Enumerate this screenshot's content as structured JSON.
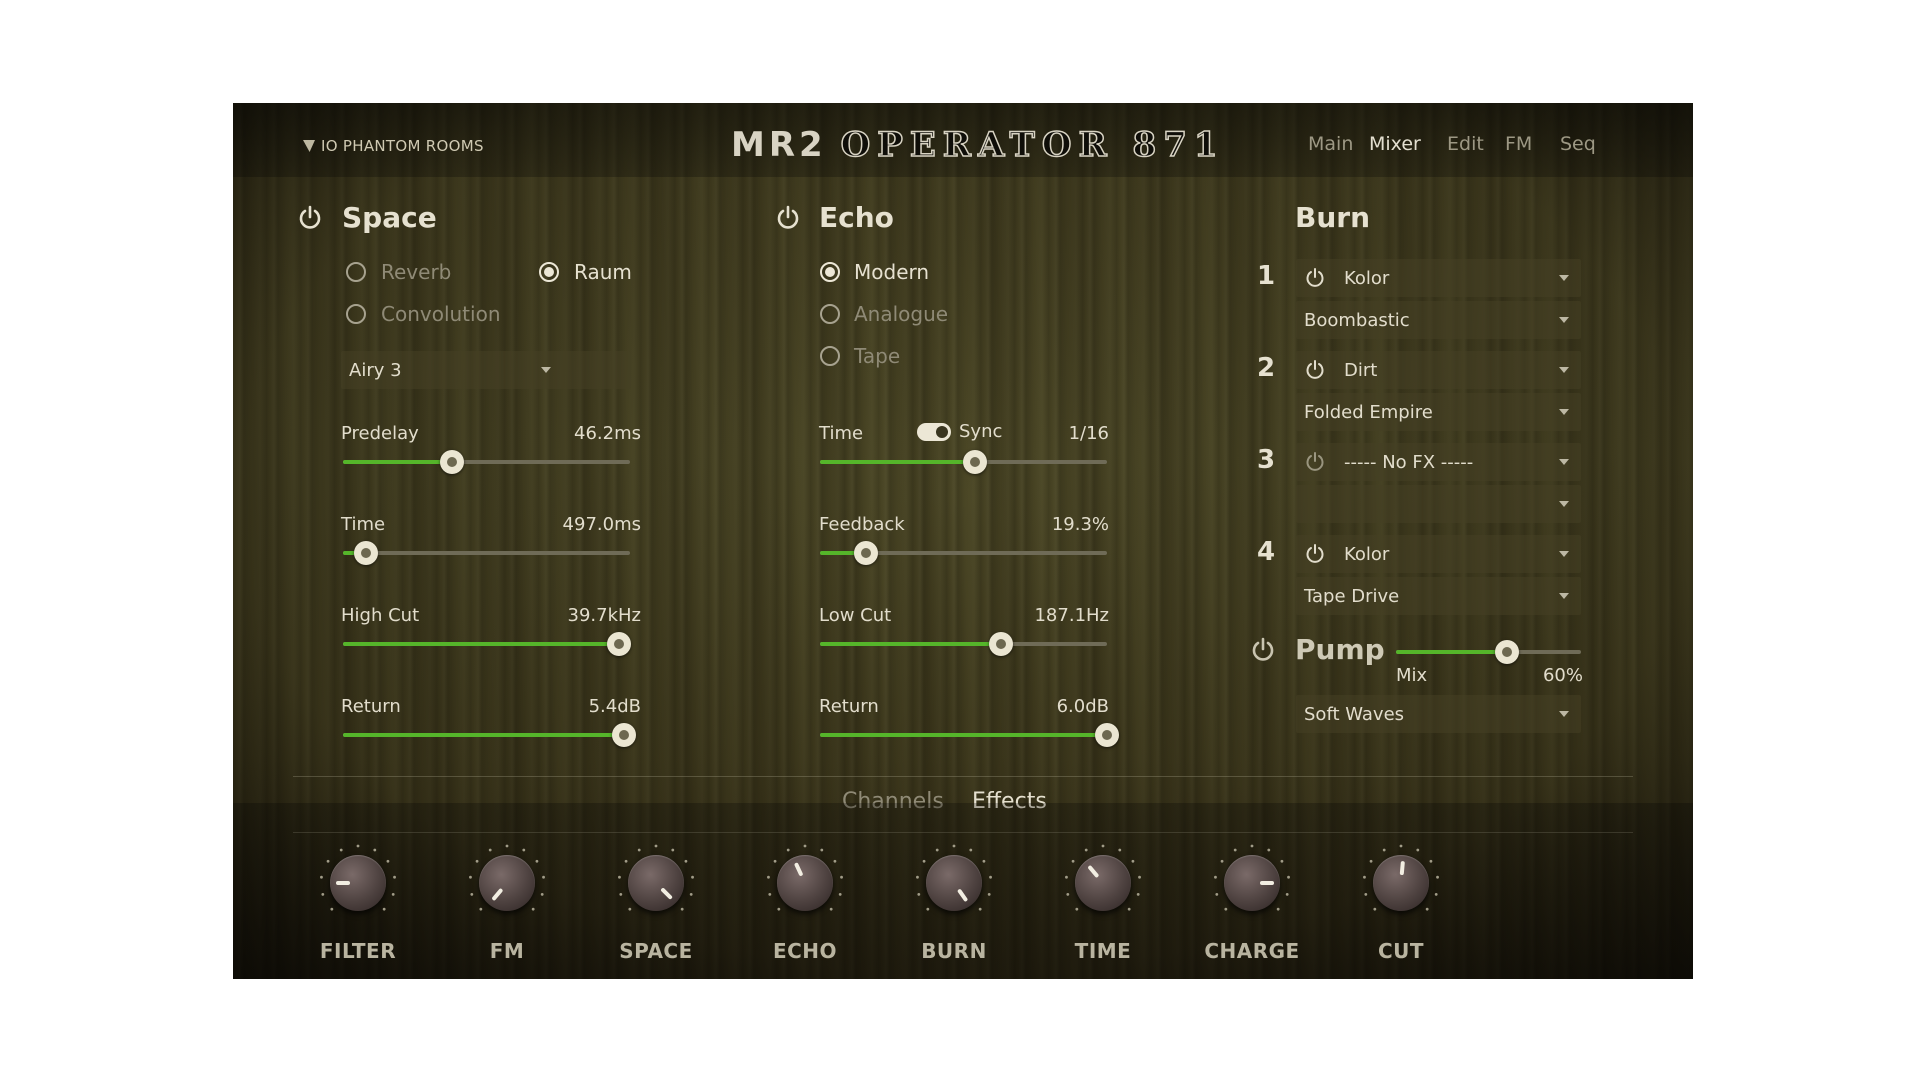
{
  "header": {
    "brand": "IO PHANTOM ROOMS",
    "title_main": "MR2",
    "title_sub": "OPERATOR 871",
    "nav": [
      "Main",
      "Mixer",
      "Edit",
      "FM",
      "Seq"
    ],
    "nav_active": "Mixer"
  },
  "space": {
    "title": "Space",
    "enabled": true,
    "modes": [
      {
        "label": "Reverb",
        "selected": false
      },
      {
        "label": "Raum",
        "selected": true
      },
      {
        "label": "Convolution",
        "selected": false
      }
    ],
    "preset": "Airy 3",
    "params": [
      {
        "label": "Predelay",
        "value": "46.2ms",
        "level": 0.38
      },
      {
        "label": "Time",
        "value": "497.0ms",
        "level": 0.08
      },
      {
        "label": "High Cut",
        "value": "39.7kHz",
        "level": 0.96
      },
      {
        "label": "Return",
        "value": "5.4dB",
        "level": 0.98
      }
    ]
  },
  "echo": {
    "title": "Echo",
    "enabled": true,
    "modes": [
      {
        "label": "Modern",
        "selected": true
      },
      {
        "label": "Analogue",
        "selected": false
      },
      {
        "label": "Tape",
        "selected": false
      }
    ],
    "sync_label": "Sync",
    "sync_on": true,
    "params": [
      {
        "label": "Time",
        "value": "1/16",
        "level": 0.54
      },
      {
        "label": "Feedback",
        "value": "19.3%",
        "level": 0.16
      },
      {
        "label": "Low Cut",
        "value": "187.1Hz",
        "level": 0.63
      },
      {
        "label": "Return",
        "value": "6.0dB",
        "level": 1.0
      }
    ]
  },
  "burn": {
    "title": "Burn",
    "slots": [
      {
        "num": "1",
        "fx": "Kolor",
        "preset": "Boombastic",
        "active": true
      },
      {
        "num": "2",
        "fx": "Dirt",
        "preset": "Folded Empire",
        "active": true
      },
      {
        "num": "3",
        "fx": "----- No FX -----",
        "preset": "",
        "active": false
      },
      {
        "num": "4",
        "fx": "Kolor",
        "preset": "Tape Drive",
        "active": true
      }
    ]
  },
  "pump": {
    "title": "Pump",
    "mix_label": "Mix",
    "mix_value": "60%",
    "level": 0.6,
    "preset": "Soft Waves"
  },
  "tabs": {
    "channels": "Channels",
    "effects": "Effects",
    "active": "Effects"
  },
  "knobs": [
    {
      "label": "FILTER",
      "angle": -90
    },
    {
      "label": "FM",
      "angle": -140
    },
    {
      "label": "SPACE",
      "angle": 135
    },
    {
      "label": "ECHO",
      "angle": -25
    },
    {
      "label": "BURN",
      "angle": 145
    },
    {
      "label": "TIME",
      "angle": -40
    },
    {
      "label": "CHARGE",
      "angle": 90
    },
    {
      "label": "CUT",
      "angle": 5
    }
  ],
  "colors": {
    "accent_green": "#55b52a",
    "text_light": "#e2ddcc",
    "text_muted": "#8f8a76"
  },
  "icons": {
    "power": "power-icon",
    "dropdown": "chevron-down-icon",
    "brand": "phantom-logo-icon"
  }
}
